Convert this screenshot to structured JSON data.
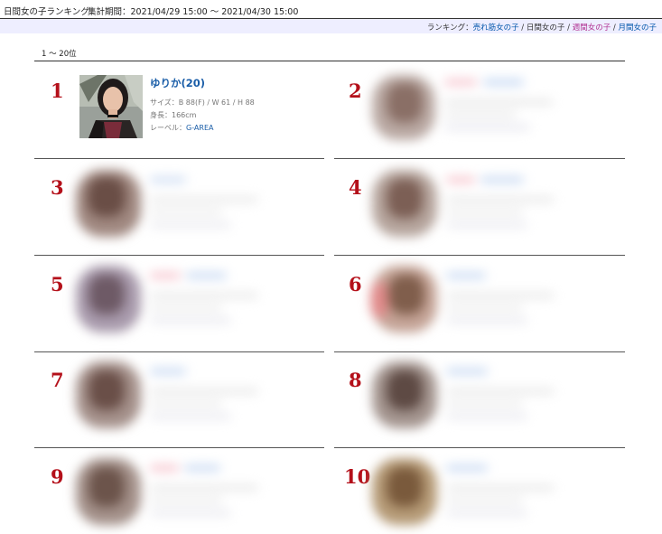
{
  "header": {
    "title": "日間女の子ランキング",
    "period_label": "集計期間：",
    "period_value": "2021/04/29 15:00 〜 2021/04/30 15:00"
  },
  "nav": {
    "prefix": "ランキング：",
    "items": [
      {
        "label": "売れ筋女の子",
        "style": "link"
      },
      {
        "label": "日間女の子",
        "style": "current"
      },
      {
        "label": "週間女の子",
        "style": "link-pink"
      },
      {
        "label": "月間女の子",
        "style": "link"
      }
    ],
    "sep": " / "
  },
  "range_text": "1 〜 20位",
  "entries": [
    {
      "rank": "1",
      "name": "ゆりか(20)",
      "size_line": "サイズ：B 88(F) / W 61 / H 88",
      "height_line": "身長：166cm",
      "label_prefix": "レーベル：",
      "label_value": "G-AREA"
    },
    {
      "rank": "2"
    },
    {
      "rank": "3"
    },
    {
      "rank": "4"
    },
    {
      "rank": "5"
    },
    {
      "rank": "6"
    },
    {
      "rank": "7"
    },
    {
      "rank": "8"
    },
    {
      "rank": "9"
    },
    {
      "rank": "10"
    }
  ],
  "colors": {
    "rank": "#b4101a",
    "link": "#1b5ea8",
    "nav_bg": "#eeeeff"
  }
}
